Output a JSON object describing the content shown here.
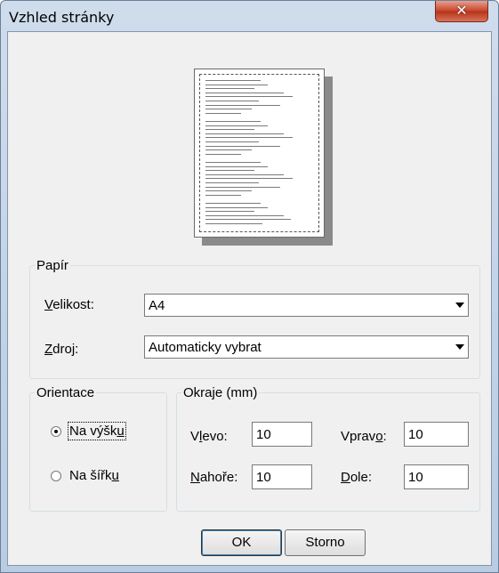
{
  "window": {
    "title": "Vzhled stránky",
    "close_glyph": "✕"
  },
  "paper": {
    "legend": "Papír",
    "size": {
      "label": "Velikost:",
      "value": "A4"
    },
    "source": {
      "label": "Zdroj:",
      "value": "Automaticky vybrat"
    }
  },
  "orientation": {
    "legend": "Orientace",
    "portrait": "Na výšku",
    "landscape": "Na šířku",
    "selected": "portrait"
  },
  "margins": {
    "legend": "Okraje (mm)",
    "left": {
      "label": "Vlevo:",
      "value": "10"
    },
    "right": {
      "label": "Vpravo:",
      "value": "10"
    },
    "top": {
      "label": "Nahoře:",
      "value": "10"
    },
    "bottom": {
      "label": "Dole:",
      "value": "10"
    }
  },
  "buttons": {
    "ok": "OK",
    "cancel": "Storno"
  },
  "icons": {
    "close": "close-icon",
    "dropdown": "chevron-down-icon"
  }
}
